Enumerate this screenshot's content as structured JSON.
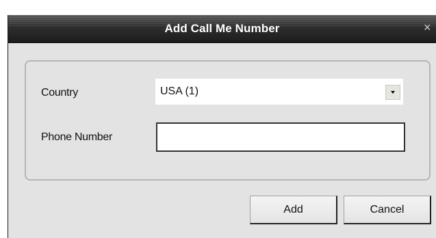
{
  "dialog": {
    "title": "Add Call Me Number",
    "close_icon": "×"
  },
  "form": {
    "country_label": "Country",
    "country_value": "USA (1)",
    "phone_label": "Phone Number",
    "phone_value": "",
    "phone_placeholder": ""
  },
  "buttons": {
    "add_label": "Add",
    "cancel_label": "Cancel"
  }
}
